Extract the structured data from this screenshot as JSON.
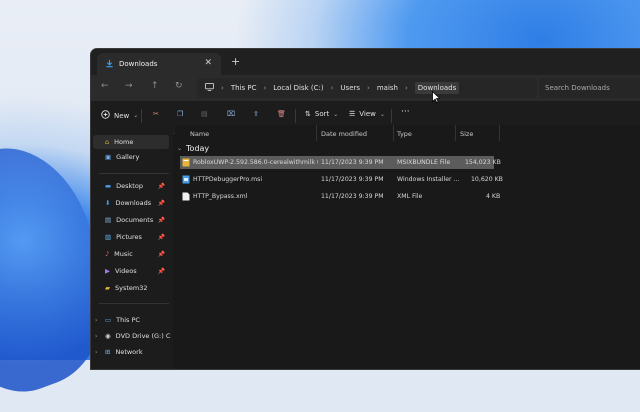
{
  "tab": {
    "title": "Downloads"
  },
  "breadcrumb": [
    "This PC",
    "Local Disk (C:)",
    "Users",
    "maish",
    "Downloads"
  ],
  "search": {
    "placeholder": "Search Downloads"
  },
  "toolbar": {
    "new_label": "New",
    "sort_label": "Sort",
    "view_label": "View"
  },
  "sidebar": {
    "home": "Home",
    "gallery": "Gallery",
    "quick": [
      "Desktop",
      "Downloads",
      "Documents",
      "Pictures",
      "Music",
      "Videos",
      "System32"
    ],
    "tree": [
      "This PC",
      "DVD Drive (G:) C",
      "Network"
    ]
  },
  "columns": {
    "name": "Name",
    "date": "Date modified",
    "type": "Type",
    "size": "Size"
  },
  "group_label": "Today",
  "files": [
    {
      "name": "RobloxUWP-2.592.586.0-cerealwithmilk (...",
      "date": "11/17/2023 9:39 PM",
      "type": "MSIXBUNDLE File",
      "size": "154,023 KB"
    },
    {
      "name": "HTTPDebuggerPro.msi",
      "date": "11/17/2023 9:39 PM",
      "type": "Windows Installer ...",
      "size": "10,620 KB"
    },
    {
      "name": "HTTP_Bypass.xml",
      "date": "11/17/2023 9:39 PM",
      "type": "XML File",
      "size": "4 KB"
    }
  ],
  "colors": {
    "accent": "#3a8ee6",
    "folder": "#e8b53a",
    "selection": "#5c5c5c"
  }
}
